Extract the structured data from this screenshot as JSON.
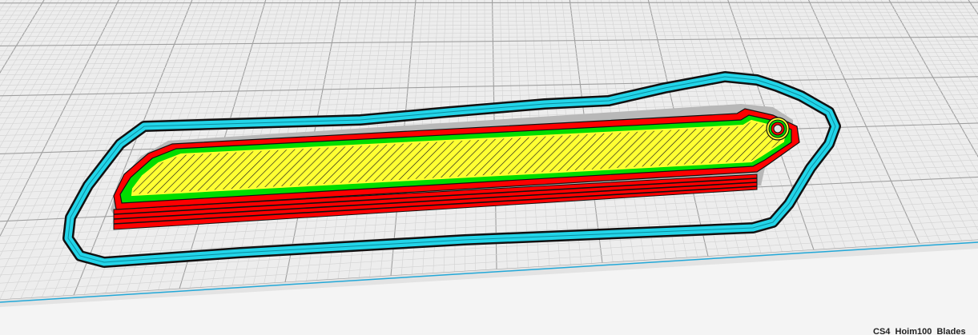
{
  "app": {
    "name": "3D printer slicer layer view"
  },
  "scene": {
    "filename": "CS4_Hoim100_Blades",
    "colors": {
      "background": "#f4f4f4",
      "build_plate": "#ededed",
      "grid_minor": "#d2d2d2",
      "grid_major": "#9f9f9f",
      "plate_edge": "#22a8d8",
      "skirt": "#22d4e8",
      "outer_wall": "#ff0000",
      "inner_wall": "#00dd00",
      "infill": "#ffff33",
      "outline": "#111111",
      "shadow": "#b8b8b8"
    },
    "legend_icons": [
      "skirt-icon",
      "outer-wall-icon",
      "inner-wall-icon",
      "infill-icon"
    ]
  }
}
